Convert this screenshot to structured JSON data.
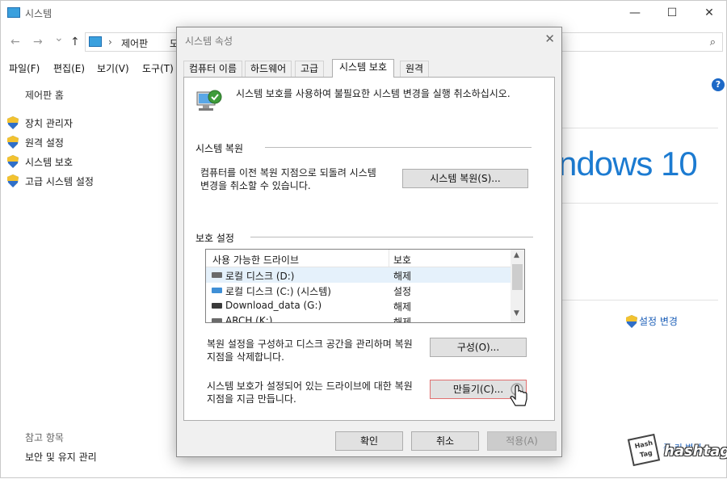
{
  "window": {
    "title": "시스템",
    "min_icon": "—",
    "max_icon": "☐",
    "close_icon": "✕"
  },
  "address": {
    "back_icon": "←",
    "forward_icon": "→",
    "dropdown_icon": "⌄",
    "up_icon": "↑",
    "separator": "›",
    "path_1": "제어판",
    "path_2": "모",
    "search_icon": "⌕"
  },
  "menu": [
    "파일(F)",
    "편집(E)",
    "보기(V)",
    "도구(T)"
  ],
  "sidebar": {
    "home": "제어판 홈",
    "items": [
      {
        "label": "장치 관리자"
      },
      {
        "label": "원격 설정"
      },
      {
        "label": "시스템 보호"
      },
      {
        "label": "고급 시스템 설정"
      }
    ],
    "related_heading": "참고 항목",
    "related_link": "보안 및 유지 관리"
  },
  "main": {
    "windows_logo_text": "ndows 10",
    "change_settings": "설정 변경",
    "help": "?",
    "bottom_link": "품 키 변경"
  },
  "watermark": {
    "box_line1": "Hash",
    "box_line2": "Tag",
    "text": "hashtag"
  },
  "dialog": {
    "title": "시스템 속성",
    "close_icon": "✕",
    "tabs": [
      "컴퓨터 이름",
      "하드웨어",
      "고급",
      "시스템 보호",
      "원격"
    ],
    "active_tab": "시스템 보호",
    "intro": "시스템 보호를 사용하여 불필요한 시스템 변경을 실행 취소하십시오.",
    "restore_group": "시스템 복원",
    "restore_desc": "컴퓨터를 이전 복원 지점으로 되돌려 시스템 변경을 취소할 수 있습니다.",
    "restore_button": "시스템 복원(S)...",
    "protection_group": "보호 설정",
    "list_headers": {
      "drive": "사용 가능한 드라이브",
      "protection": "보호"
    },
    "drives": [
      {
        "name": "로컬 디스크 (D:)",
        "protection": "해제"
      },
      {
        "name": "로컬 디스크 (C:) (시스템)",
        "protection": "설정"
      },
      {
        "name": "Download_data (G:)",
        "protection": "해제"
      },
      {
        "name": "ARCH (K:)",
        "protection": "해제"
      }
    ],
    "configure_desc": "복원 설정을 구성하고 디스크 공간을 관리하며 복원 지점을 삭제합니다.",
    "configure_button": "구성(O)...",
    "create_desc": "시스템 보호가 설정되어 있는 드라이브에 대한 복원 지점을 지금 만듭니다.",
    "create_button": "만들기(C)...",
    "ok_button": "확인",
    "cancel_button": "취소",
    "apply_button": "적용(A)",
    "scroll_up": "▲",
    "scroll_down": "▼"
  }
}
